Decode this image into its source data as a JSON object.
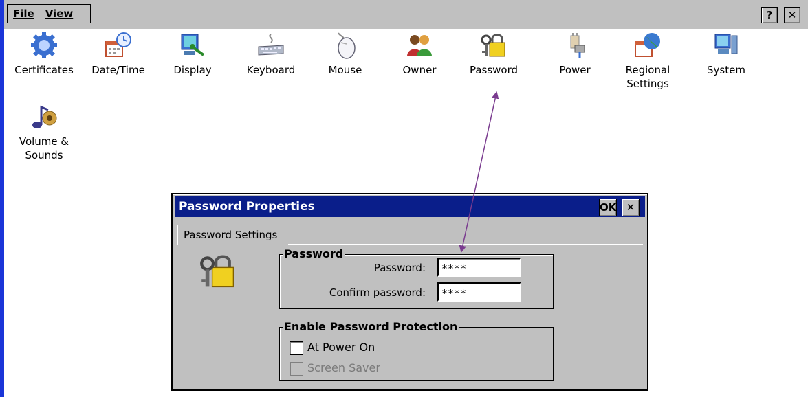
{
  "menubar": {
    "file_label": "File",
    "view_label": "View",
    "help_label": "?",
    "close_label": "✕"
  },
  "icons": [
    {
      "label": "Certificates",
      "icon": "gear-icon"
    },
    {
      "label": "Date/Time",
      "icon": "calendar-clock-icon"
    },
    {
      "label": "Display",
      "icon": "monitor-icon"
    },
    {
      "label": "Keyboard",
      "icon": "keyboard-icon"
    },
    {
      "label": "Mouse",
      "icon": "mouse-icon"
    },
    {
      "label": "Owner",
      "icon": "users-icon"
    },
    {
      "label": "Password",
      "icon": "lock-icon"
    },
    {
      "label": "Power",
      "icon": "power-plug-icon"
    },
    {
      "label": "Regional\nSettings",
      "icon": "globe-icon"
    },
    {
      "label": "System",
      "icon": "computer-icon"
    },
    {
      "label": "Volume &\nSounds",
      "icon": "speaker-icon"
    }
  ],
  "dialog": {
    "title": "Password Properties",
    "ok_label": "OK",
    "close_label": "✕",
    "tab_label": "Password Settings",
    "password_group": {
      "title": "Password",
      "password_label": "Password:",
      "password_value": "****",
      "confirm_label": "Confirm password:",
      "confirm_value": "****"
    },
    "protection_group": {
      "title": "Enable Password Protection",
      "power_on_label": "At Power On",
      "power_on_checked": false,
      "screen_saver_label": "Screen Saver",
      "screen_saver_checked": false,
      "screen_saver_enabled": false
    }
  },
  "colors": {
    "titlebar": "#0a1e8a",
    "arrow": "#7a3b8f",
    "window_border": "#1a35d8"
  }
}
